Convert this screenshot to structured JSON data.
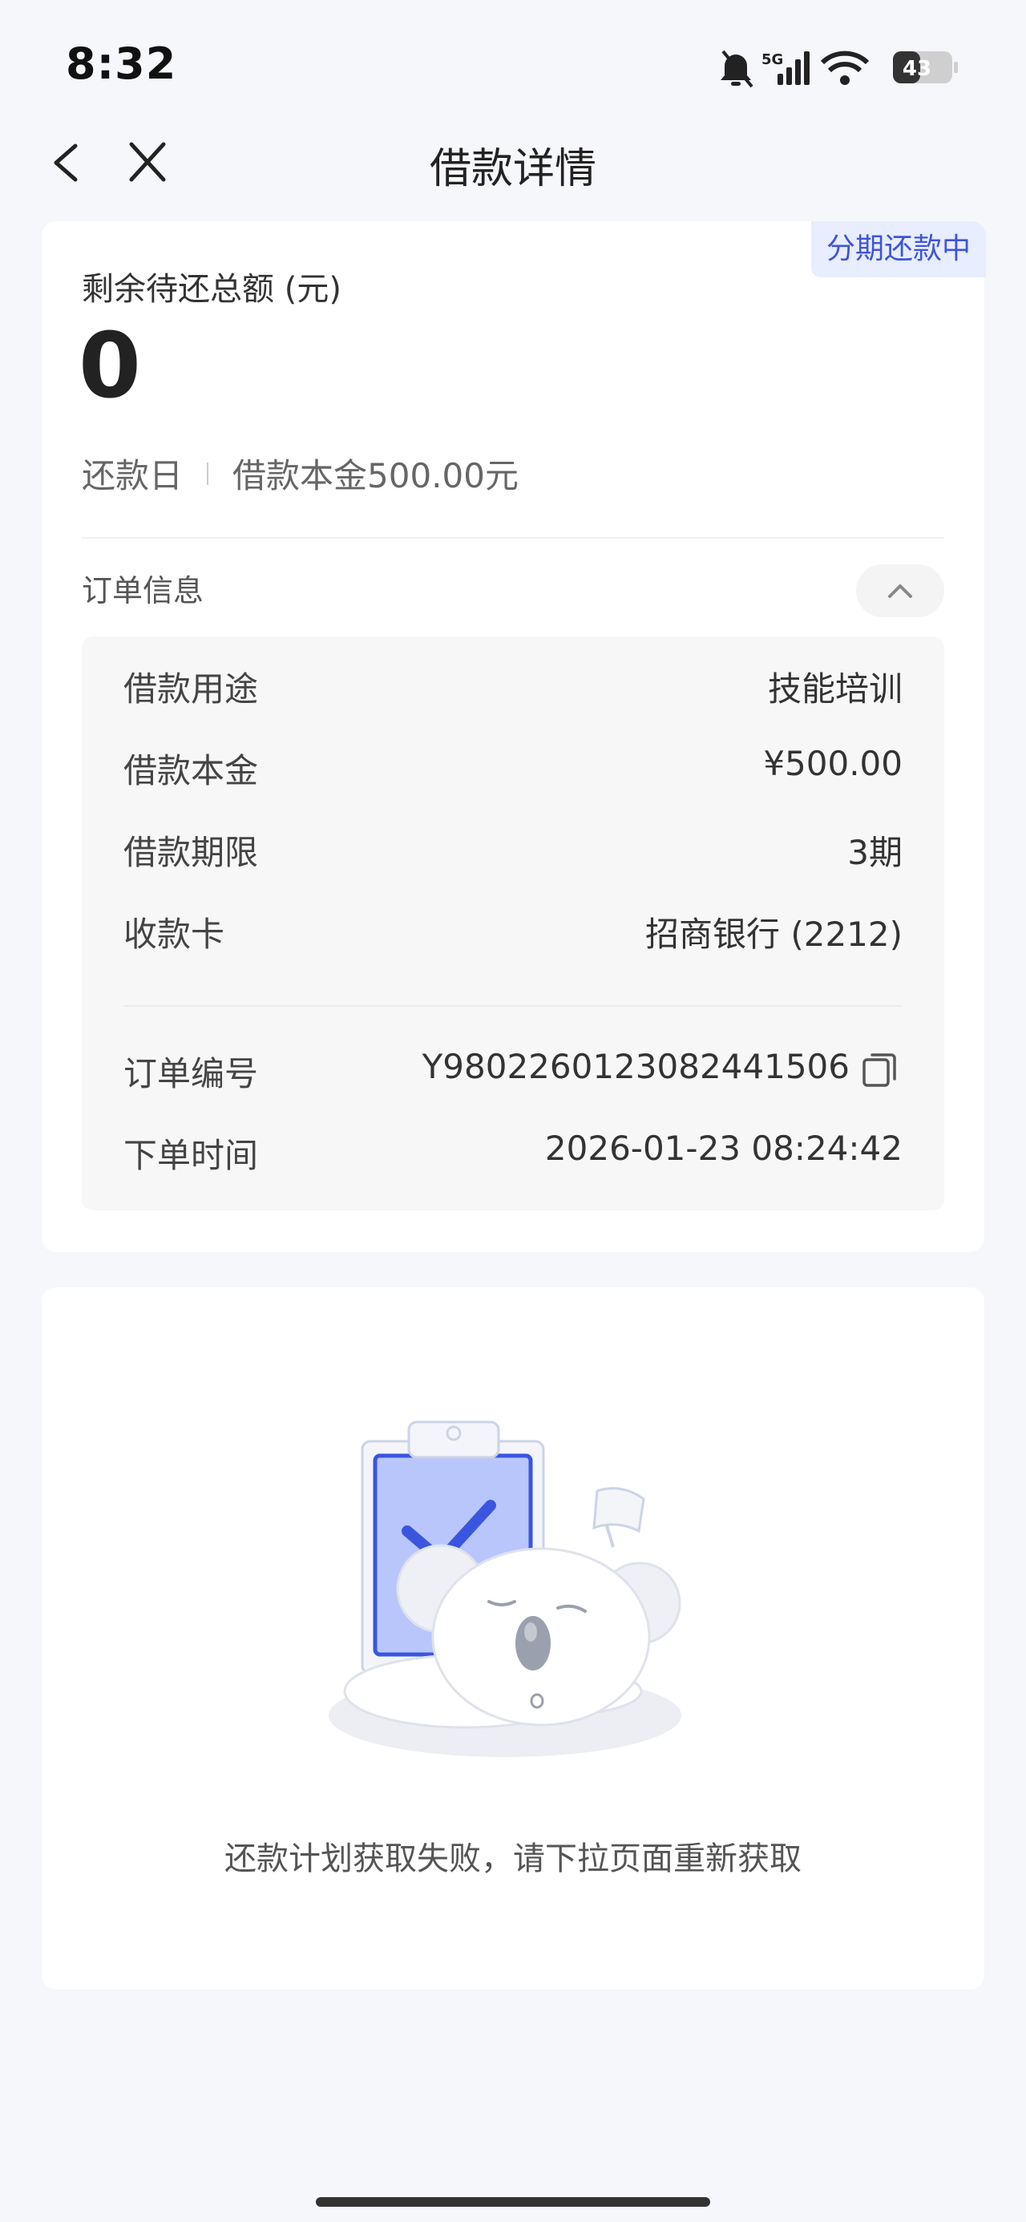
{
  "status_bar": {
    "time": "8:32",
    "network": "5G",
    "battery": "43"
  },
  "nav": {
    "title": "借款详情"
  },
  "summary": {
    "badge": "分期还款中",
    "remain_label": "剩余待还总额 (元)",
    "remain_value": "0",
    "repay_day_label": "还款日",
    "principal_text": "借款本金500.00元"
  },
  "order": {
    "title": "订单信息",
    "rows": [
      {
        "label": "借款用途",
        "value": "技能培训"
      },
      {
        "label": "借款本金",
        "value": "¥500.00"
      },
      {
        "label": "借款期限",
        "value": "3期"
      },
      {
        "label": "收款卡",
        "value": "招商银行 (2212)"
      }
    ],
    "order_no_label": "订单编号",
    "order_no_value": "Y980226012308244150​6",
    "order_time_label": "下单时间",
    "order_time_value": "2026-01-23 08:24:42"
  },
  "plan": {
    "fail_message": "还款计划获取失败，请下拉页面重新获取"
  },
  "colors": {
    "accent": "#3f55d6",
    "badge_bg": "#e8edff",
    "page_bg": "#f6f7fb"
  }
}
